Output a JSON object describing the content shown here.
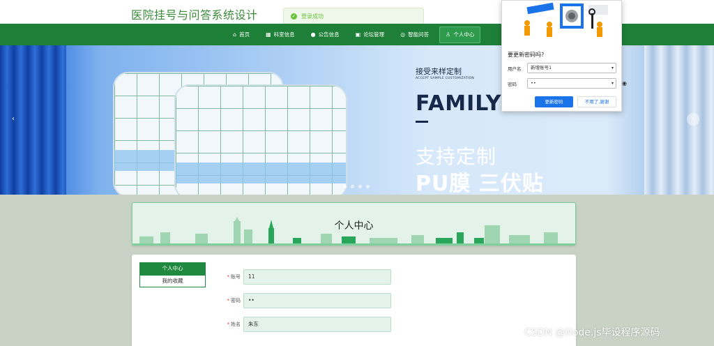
{
  "site": {
    "title": "医院挂号与问答系统设计"
  },
  "toast": {
    "message": "登录成功"
  },
  "nav": {
    "items": [
      {
        "label": "首页",
        "icon": "home-icon"
      },
      {
        "label": "科室信息",
        "icon": "grid-icon"
      },
      {
        "label": "公告信息",
        "icon": "info-icon"
      },
      {
        "label": "论坛管理",
        "icon": "forum-icon"
      },
      {
        "label": "智能问答",
        "icon": "chat-icon"
      },
      {
        "label": "个人中心",
        "icon": "user-icon",
        "active": true
      }
    ]
  },
  "banner": {
    "caption": "接受来样定制",
    "subcaption": "ACCEPT SAMPLE CUSTOMIZATION",
    "headline": "FAMILY S",
    "cn_line1": "支持定制",
    "cn_line2": "PU膜 三伏贴",
    "slide_count": 4,
    "active_slide": 1
  },
  "page": {
    "title": "个人中心"
  },
  "side_menu": [
    {
      "label": "个人中心",
      "active": true
    },
    {
      "label": "我的收藏",
      "active": false
    }
  ],
  "form": {
    "fields": [
      {
        "label": "账号",
        "value": "11",
        "required": true
      },
      {
        "label": "密码",
        "value": "••",
        "required": true
      },
      {
        "label": "姓名",
        "value": "朱东",
        "required": true
      }
    ]
  },
  "password_popup": {
    "question": "要更新密码吗?",
    "username_label": "用户名",
    "username_value": "新增账号1",
    "password_label": "密码",
    "password_value": "••",
    "update_button": "更新密码",
    "dismiss_button": "不用了,谢谢"
  },
  "watermark": "CSDN @Node.js毕设程序源码",
  "colors": {
    "nav": "#1e7f38",
    "accent": "#1f8a3f",
    "link": "#1a73e8"
  }
}
